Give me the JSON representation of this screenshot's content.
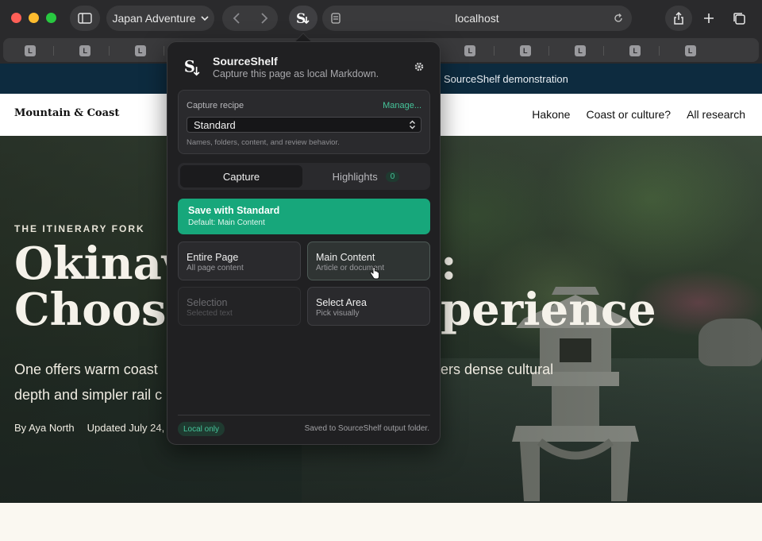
{
  "browser": {
    "tab_group": "Japan Adventure",
    "address": "localhost",
    "tab_favicon_letter": "L",
    "tab_count": 13
  },
  "site": {
    "banner": "SourceShelf demonstration",
    "brand": "Mountain & Coast",
    "nav": [
      "Hakone",
      "Coast or culture?",
      "All research"
    ],
    "kicker": "THE ITINERARY FORK",
    "headline_line1": "Okinav",
    "headline_line1_tail": ":",
    "headline_line2": "Choos",
    "headline_line2_tail": "perience",
    "dek_line1": "One offers warm coast",
    "dek_line1_tail": "ers dense cultural",
    "dek_line2": "depth and simpler rail c",
    "author": "By Aya North",
    "updated": "Updated July 24,"
  },
  "popup": {
    "title": "SourceShelf",
    "subtitle": "Capture this page as local Markdown.",
    "recipe": {
      "label": "Capture recipe",
      "manage": "Manage...",
      "selected": "Standard",
      "note": "Names, folders, content, and review behavior."
    },
    "tabs": {
      "capture": "Capture",
      "highlights": "Highlights",
      "highlights_count": "0"
    },
    "save": {
      "title": "Save with Standard",
      "subtitle": "Default: Main Content"
    },
    "options": [
      {
        "title": "Entire Page",
        "subtitle": "All page content",
        "state": "normal"
      },
      {
        "title": "Main Content",
        "subtitle": "Article or document",
        "state": "active"
      },
      {
        "title": "Selection",
        "subtitle": "Selected text",
        "state": "disabled"
      },
      {
        "title": "Select Area",
        "subtitle": "Pick visually",
        "state": "normal"
      }
    ],
    "footer": {
      "badge": "Local only",
      "note": "Saved to SourceShelf output folder."
    }
  },
  "colors": {
    "accent": "#17a77b",
    "accent_text": "#45c49a",
    "banner_bg": "#0d2b3f",
    "popup_bg": "#202022"
  },
  "icons": [
    "sidebar-icon",
    "chevron-down-icon",
    "back-icon",
    "forward-icon",
    "sourceshelf-icon",
    "reader-icon",
    "reload-icon",
    "share-icon",
    "plus-icon",
    "tabs-overview-icon",
    "gear-icon",
    "hand-cursor-icon"
  ]
}
